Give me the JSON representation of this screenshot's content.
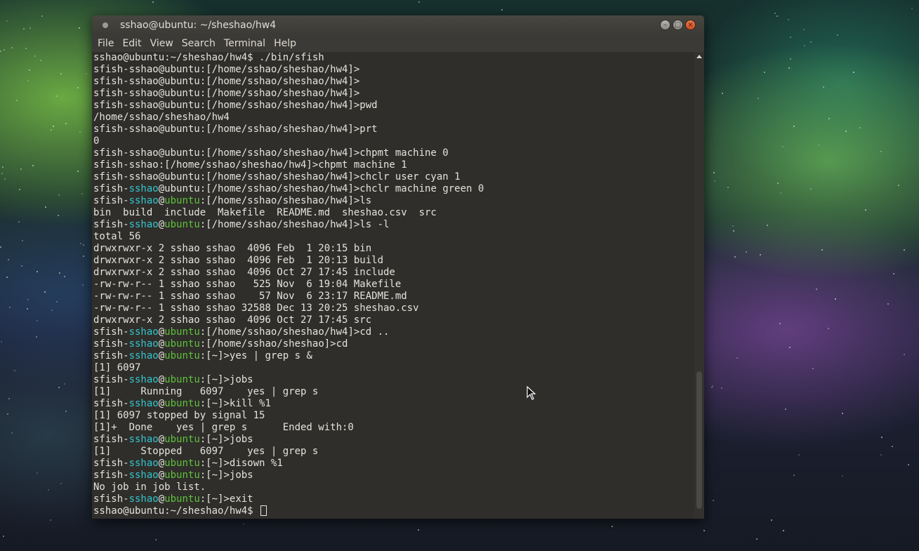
{
  "window": {
    "title": "sshao@ubuntu: ~/sheshao/hw4",
    "buttons": {
      "minimize": "–",
      "maximize": "□",
      "close": "×"
    }
  },
  "menubar": {
    "items": [
      "File",
      "Edit",
      "View",
      "Search",
      "Terminal",
      "Help"
    ]
  },
  "terminal": {
    "lines": [
      [
        [
          "",
          "sshao@ubuntu:~/sheshao/hw4$ ./bin/sfish"
        ]
      ],
      [
        [
          "",
          "sfish-sshao@ubuntu:[/home/sshao/sheshao/hw4]>"
        ]
      ],
      [
        [
          "",
          "sfish-sshao@ubuntu:[/home/sshao/sheshao/hw4]>"
        ]
      ],
      [
        [
          "",
          "sfish-sshao@ubuntu:[/home/sshao/sheshao/hw4]>"
        ]
      ],
      [
        [
          "",
          "sfish-sshao@ubuntu:[/home/sshao/sheshao/hw4]>pwd"
        ]
      ],
      [
        [
          "",
          "/home/sshao/sheshao/hw4"
        ]
      ],
      [
        [
          "",
          "sfish-sshao@ubuntu:[/home/sshao/sheshao/hw4]>prt"
        ]
      ],
      [
        [
          "",
          "0"
        ]
      ],
      [
        [
          "",
          "sfish-sshao@ubuntu:[/home/sshao/sheshao/hw4]>chpmt machine 0"
        ]
      ],
      [
        [
          "",
          "sfish-sshao:[/home/sshao/sheshao/hw4]>chpmt machine 1"
        ]
      ],
      [
        [
          "",
          "sfish-sshao@ubuntu:[/home/sshao/sheshao/hw4]>chclr user cyan 1"
        ]
      ],
      [
        [
          "",
          "sfish-"
        ],
        [
          "cyan",
          "sshao"
        ],
        [
          "",
          "@ubuntu:[/home/sshao/sheshao/hw4]>chclr machine green 0"
        ]
      ],
      [
        [
          "",
          "sfish-"
        ],
        [
          "cyan",
          "sshao"
        ],
        [
          "",
          "@"
        ],
        [
          "green",
          "ubuntu"
        ],
        [
          "",
          ":[/home/sshao/sheshao/hw4]>ls"
        ]
      ],
      [
        [
          "",
          "bin  build  include  Makefile  README.md  sheshao.csv  src"
        ]
      ],
      [
        [
          "",
          "sfish-"
        ],
        [
          "cyan",
          "sshao"
        ],
        [
          "",
          "@"
        ],
        [
          "green",
          "ubuntu"
        ],
        [
          "",
          ":[/home/sshao/sheshao/hw4]>ls -l"
        ]
      ],
      [
        [
          "",
          "total 56"
        ]
      ],
      [
        [
          "",
          "drwxrwxr-x 2 sshao sshao  4096 Feb  1 20:15 bin"
        ]
      ],
      [
        [
          "",
          "drwxrwxr-x 2 sshao sshao  4096 Feb  1 20:13 build"
        ]
      ],
      [
        [
          "",
          "drwxrwxr-x 2 sshao sshao  4096 Oct 27 17:45 include"
        ]
      ],
      [
        [
          "",
          "-rw-rw-r-- 1 sshao sshao   525 Nov  6 19:04 Makefile"
        ]
      ],
      [
        [
          "",
          "-rw-rw-r-- 1 sshao sshao    57 Nov  6 23:17 README.md"
        ]
      ],
      [
        [
          "",
          "-rw-rw-r-- 1 sshao sshao 32588 Dec 13 20:25 sheshao.csv"
        ]
      ],
      [
        [
          "",
          "drwxrwxr-x 2 sshao sshao  4096 Oct 27 17:45 src"
        ]
      ],
      [
        [
          "",
          "sfish-"
        ],
        [
          "cyan",
          "sshao"
        ],
        [
          "",
          "@"
        ],
        [
          "green",
          "ubuntu"
        ],
        [
          "",
          ":[/home/sshao/sheshao/hw4]>cd .."
        ]
      ],
      [
        [
          "",
          "sfish-"
        ],
        [
          "cyan",
          "sshao"
        ],
        [
          "",
          "@"
        ],
        [
          "green",
          "ubuntu"
        ],
        [
          "",
          ":[/home/sshao/sheshao]>cd"
        ]
      ],
      [
        [
          "",
          "sfish-"
        ],
        [
          "cyan",
          "sshao"
        ],
        [
          "",
          "@"
        ],
        [
          "green",
          "ubuntu"
        ],
        [
          "",
          ":[~]>yes | grep s &"
        ]
      ],
      [
        [
          "",
          "[1] 6097"
        ]
      ],
      [
        [
          "",
          "sfish-"
        ],
        [
          "cyan",
          "sshao"
        ],
        [
          "",
          "@"
        ],
        [
          "green",
          "ubuntu"
        ],
        [
          "",
          ":[~]>jobs"
        ]
      ],
      [
        [
          "",
          "[1]     Running   6097    yes | grep s"
        ]
      ],
      [
        [
          "",
          "sfish-"
        ],
        [
          "cyan",
          "sshao"
        ],
        [
          "",
          "@"
        ],
        [
          "green",
          "ubuntu"
        ],
        [
          "",
          ":[~]>kill %1"
        ]
      ],
      [
        [
          "",
          "[1] 6097 stopped by signal 15"
        ]
      ],
      [
        [
          "",
          "[1]+  Done    yes | grep s      Ended with:0"
        ]
      ],
      [
        [
          "",
          "sfish-"
        ],
        [
          "cyan",
          "sshao"
        ],
        [
          "",
          "@"
        ],
        [
          "green",
          "ubuntu"
        ],
        [
          "",
          ":[~]>jobs"
        ]
      ],
      [
        [
          "",
          "[1]     Stopped   6097    yes | grep s"
        ]
      ],
      [
        [
          "",
          "sfish-"
        ],
        [
          "cyan",
          "sshao"
        ],
        [
          "",
          "@"
        ],
        [
          "green",
          "ubuntu"
        ],
        [
          "",
          ":[~]>disown %1"
        ]
      ],
      [
        [
          "",
          "sfish-"
        ],
        [
          "cyan",
          "sshao"
        ],
        [
          "",
          "@"
        ],
        [
          "green",
          "ubuntu"
        ],
        [
          "",
          ":[~]>jobs"
        ]
      ],
      [
        [
          "",
          "No job in job list."
        ]
      ],
      [
        [
          "",
          "sfish-"
        ],
        [
          "cyan",
          "sshao"
        ],
        [
          "",
          "@"
        ],
        [
          "green",
          "ubuntu"
        ],
        [
          "",
          ":[~]>exit"
        ]
      ],
      [
        [
          "",
          "sshao@ubuntu:~/sheshao/hw4$ "
        ]
      ]
    ],
    "colors": {
      "background": "#2f2e2b",
      "foreground": "#e6e3dc",
      "cyan": "#34c4cc",
      "green": "#5ec23a"
    }
  },
  "icons": {
    "title": "terminal-dot-icon",
    "cursor": "text-cursor-icon",
    "pointer": "mouse-pointer-icon"
  }
}
